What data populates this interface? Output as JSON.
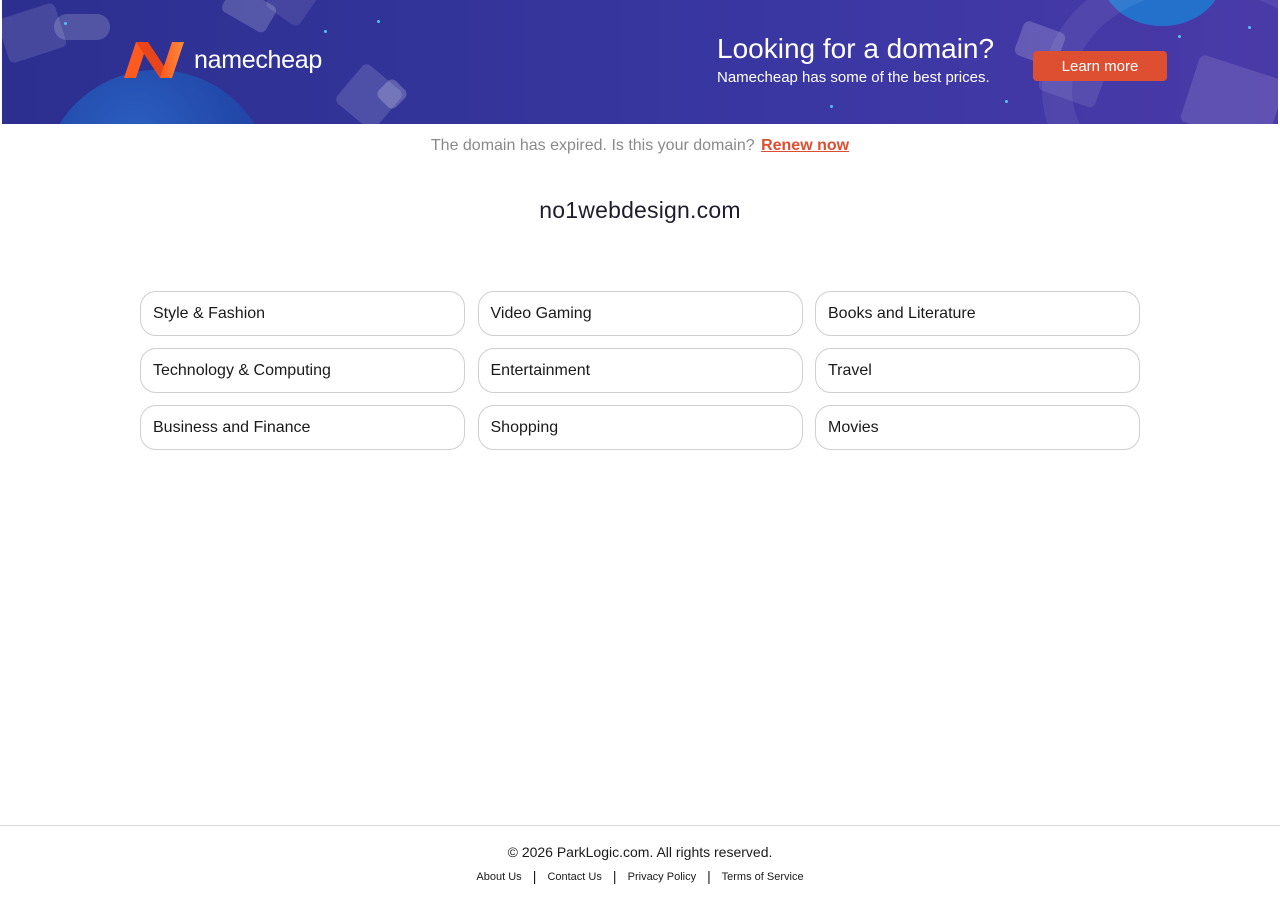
{
  "banner": {
    "brand": "namecheap",
    "promo_title": "Looking for a domain?",
    "promo_subtitle": "Namecheap has some of the best prices.",
    "cta_label": "Learn more",
    "colors": {
      "background": "#33349a",
      "cta": "#de4f31",
      "logo_orange": "#ff6a2c"
    }
  },
  "notice": {
    "text": "The domain has expired. Is this your domain?",
    "link_label": "Renew now"
  },
  "domain_name": "no1webdesign.com",
  "categories": [
    "Style & Fashion",
    "Video Gaming",
    "Books and Literature",
    "Technology & Computing",
    "Entertainment",
    "Travel",
    "Business and Finance",
    "Shopping",
    "Movies"
  ],
  "footer": {
    "copyright": "© 2026 ParkLogic.com. All rights reserved.",
    "links": [
      "About Us",
      "Contact Us",
      "Privacy Policy",
      "Terms of Service"
    ],
    "separator": "|"
  }
}
